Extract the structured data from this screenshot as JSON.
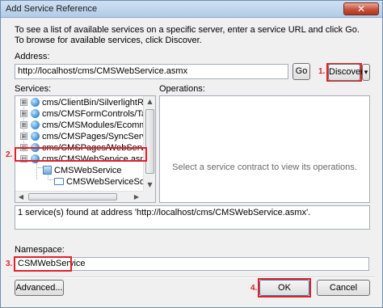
{
  "window": {
    "title": "Add Service Reference",
    "close_glyph": "✕"
  },
  "intro_text": "To see a list of available services on a specific server, enter a service URL and click Go. To browse for available services, click Discover.",
  "address": {
    "label": "Address:",
    "value": "http://localhost/cms/CMSWebService.asmx",
    "go_label": "Go",
    "discover_label": "Discover",
    "discover_arrow": "▾"
  },
  "services": {
    "label": "Services:",
    "items": [
      {
        "label": "cms/ClientBin/SilverlightRepeate"
      },
      {
        "label": "cms/CMSFormControls/TagSele"
      },
      {
        "label": "cms/CMSModules/Ecommerce/"
      },
      {
        "label": "cms/CMSPages/SyncServer.asm"
      },
      {
        "label": "cms/CMSPages/WebService.asm"
      },
      {
        "label": "cms/CMSWebService.asmx"
      },
      {
        "label": "CMSWebService"
      },
      {
        "label": "CMSWebServiceSoap"
      }
    ]
  },
  "operations": {
    "label": "Operations:",
    "placeholder": "Select a service contract to view its operations."
  },
  "status_text": "1 service(s) found at address 'http://localhost/cms/CMSWebService.asmx'.",
  "namespace": {
    "label": "Namespace:",
    "value": "CSMWebService"
  },
  "buttons": {
    "advanced": "Advanced...",
    "ok": "OK",
    "cancel": "Cancel"
  },
  "callouts": [
    "1.",
    "2.",
    "3.",
    "4."
  ],
  "colors": {
    "callout": "#e2202a",
    "title_bar": "#b3cbe7",
    "close_button": "#c6503b"
  },
  "icons": {
    "expand": "⊞",
    "collapse": "⊟",
    "scroll_up": "▲",
    "scroll_down": "▼",
    "scroll_left": "◀",
    "scroll_right": "▶"
  }
}
